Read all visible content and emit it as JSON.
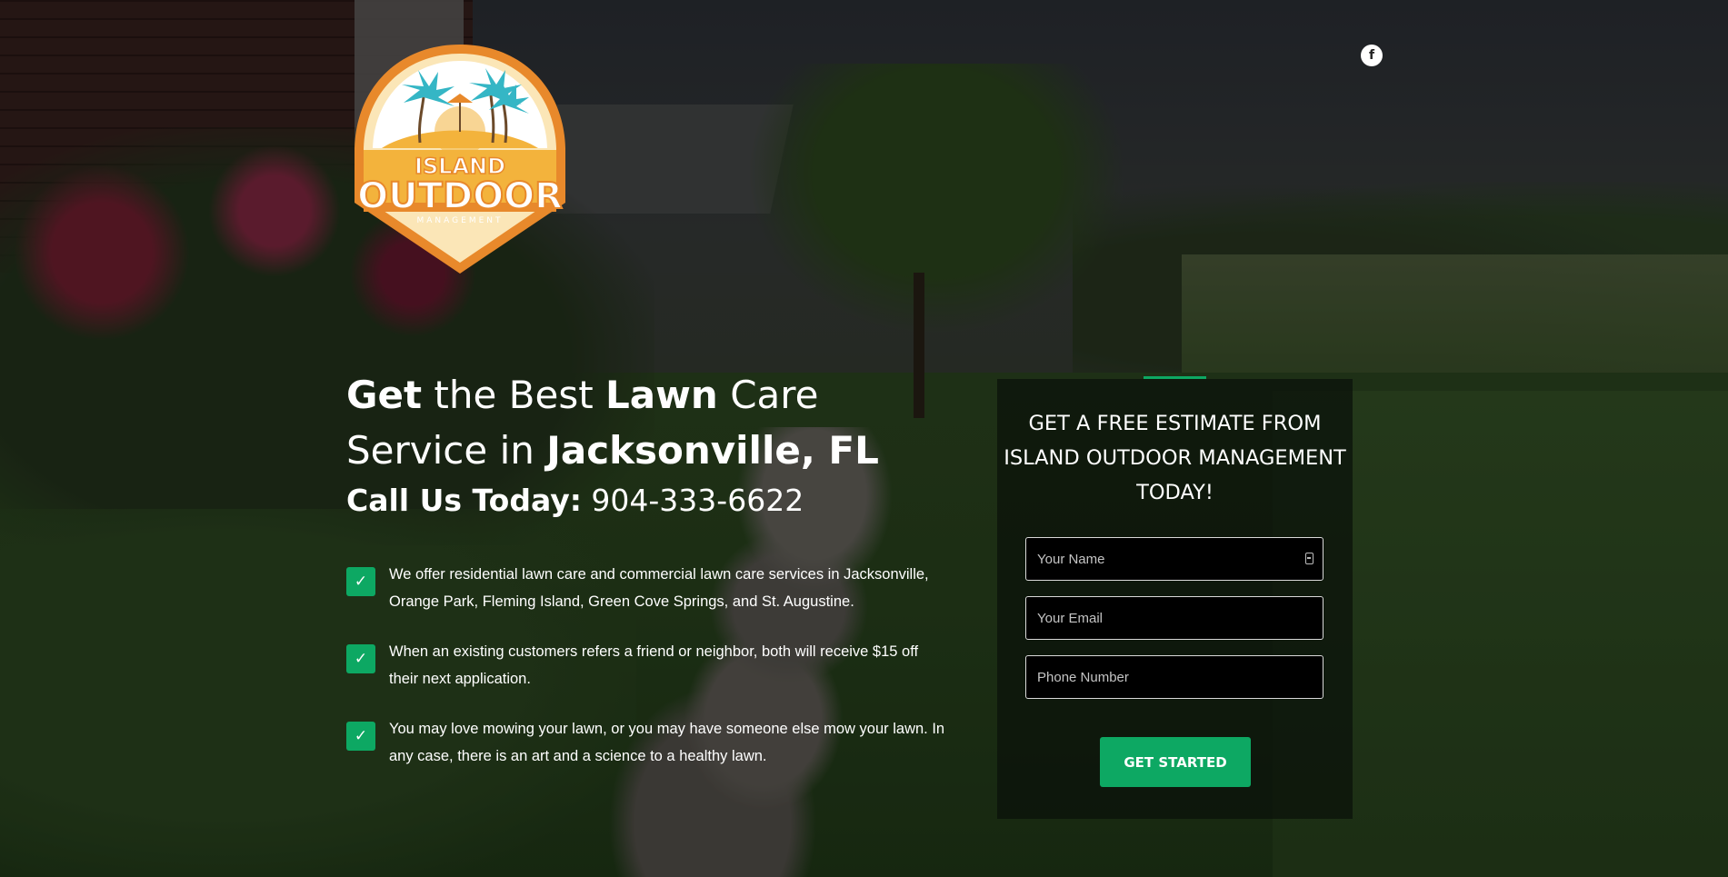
{
  "brand": {
    "logo_line1": "ISLAND",
    "logo_line2": "OUTDOOR",
    "logo_line3": "MANAGEMENT",
    "colors": {
      "orange": "#E8892B",
      "gold": "#F3B33C",
      "cream": "#FBE6B7",
      "teal": "#35B6C5",
      "accent_green": "#0DA863"
    }
  },
  "social": {
    "facebook_glyph": "f"
  },
  "hero": {
    "headline_word1": "Get",
    "headline_word2": " the Best ",
    "headline_word3": "Lawn",
    "headline_word4": " Care Service in ",
    "headline_word5": "Jacksonville, FL",
    "callus_label": "Call Us Today:",
    "callus_phone": " 904-333-6622"
  },
  "bullets": [
    {
      "text": "We offer residential lawn care and commercial lawn care services in Jacksonville, Orange Park, Fleming Island, Green Cove Springs, and St. Augustine."
    },
    {
      "text": "When an existing customers refers a friend or neighbor, both will receive $15 off their next application."
    },
    {
      "text": "You may love mowing your lawn, or you may have someone else mow your lawn. In any case, there is an art and a science to a healthy lawn."
    }
  ],
  "check_glyph": "✓",
  "form": {
    "title": "GET A FREE ESTIMATE FROM ISLAND OUTDOOR MANAGEMENT TODAY!",
    "name_placeholder": "Your Name",
    "email_placeholder": "Your Email",
    "phone_placeholder": "Phone Number",
    "submit_label": "GET STARTED"
  }
}
